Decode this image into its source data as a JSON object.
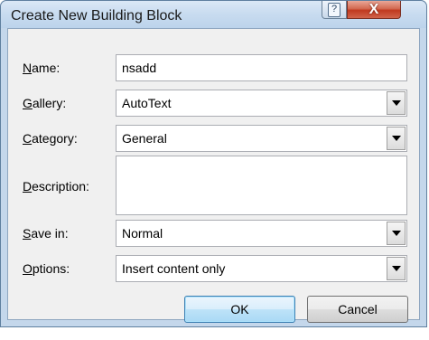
{
  "window": {
    "title": "Create New Building Block",
    "help_glyph": "?",
    "close_glyph": "X"
  },
  "form": {
    "name": {
      "label_key": "N",
      "label_rest": "ame:",
      "value": "nsadd"
    },
    "gallery": {
      "label_key": "G",
      "label_rest": "allery:",
      "value": "AutoText"
    },
    "category": {
      "label_key": "C",
      "label_rest": "ategory:",
      "value": "General"
    },
    "description": {
      "label_key": "D",
      "label_rest": "escription:",
      "value": ""
    },
    "save_in": {
      "label_key": "S",
      "label_rest": "ave in:",
      "value": "Normal"
    },
    "options": {
      "label_key": "O",
      "label_rest": "ptions:",
      "value": "Insert content only"
    }
  },
  "buttons": {
    "ok": "OK",
    "cancel": "Cancel"
  },
  "icons": {
    "help": "help-icon",
    "close": "close-icon",
    "dropdown": "chevron-down-icon"
  }
}
